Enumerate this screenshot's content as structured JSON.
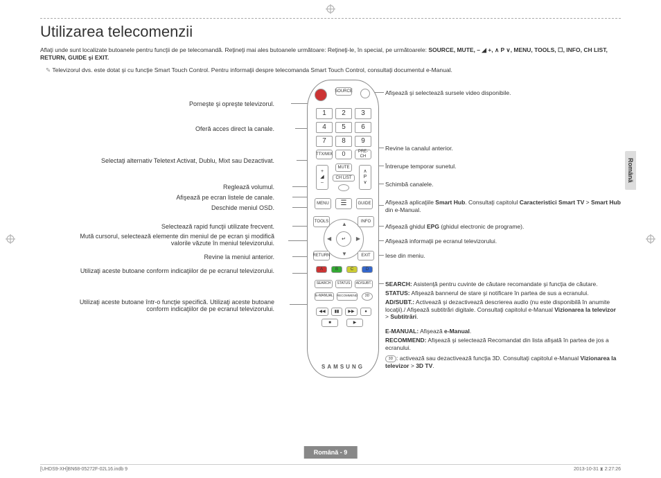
{
  "title": "Utilizarea telecomenzii",
  "intro": "Aflaţi unde sunt localizate butoanele pentru funcţii de pe telecomandă. Reţineţi mai ales butoanele următoare: Reţineţi-le, în special, pe următoarele: ",
  "introKeys": "SOURCE, MUTE, – ◢ +, ∧ P ∨, MENU, TOOLS, ☐, INFO, CH LIST, RETURN, GUIDE şi EXIT.",
  "note": "Televizorul dvs. este dotat şi cu funcţie Smart Touch Control. Pentru informaţii despre telecomanda Smart Touch Control, consultaţi documentul e-Manual.",
  "left": {
    "power": "Porneşte şi opreşte televizorul.",
    "direct": "Oferă acces direct la canale.",
    "ttx": "Selectaţi alternativ Teletext Activat, Dublu, Mixt sau Dezactivat.",
    "vol": "Reglează volumul.",
    "chlist": "Afişează pe ecran listele de canale.",
    "menu": "Deschide meniul OSD.",
    "tools": "Selectează rapid funcţii utilizate frecvent.",
    "nav": "Mută cursorul, selectează elemente din meniul de pe ecran şi modifică valorile văzute în meniul televizorului.",
    "return": "Revine la meniul anterior.",
    "colors": "Utilizaţi aceste butoane conform indicaţiilor de pe ecranul televizorului.",
    "bottom": "Utilizaţi aceste butoane într-o funcţie specifică. Utilizaţi aceste butoane conform indicaţiilor de pe ecranul televizorului."
  },
  "right": {
    "source": "Afişează şi selectează sursele video disponibile.",
    "prech": "Revine la canalul anterior.",
    "mute": "Întrerupe temporar sunetul.",
    "ch": "Schimbă canalele.",
    "smarthub": "Afişează aplicaţiile ",
    "smarthub_b1": "Smart Hub",
    "smarthub2": ". Consultaţi capitolul ",
    "smarthub_b2": "Caracteristici Smart TV",
    "smarthub3": " > ",
    "smarthub_b3": "Smart Hub",
    "smarthub4": " din e-Manual.",
    "guide": "Afişează ghidul ",
    "guide_b": "EPG",
    "guide2": " (ghidul electronic de programe).",
    "info": "Afişează informaţii pe ecranul televizorului.",
    "exit": "Iese din meniu.",
    "search_l": "SEARCH:",
    "search": " Asistenţă pentru cuvinte de căutare recomandate şi funcţia de căutare.",
    "status_l": "STATUS:",
    "status": " Afişează bannerul de stare şi notificare în partea de sus a ecranului.",
    "adsubt_l": "AD/SUBT.:",
    "adsubt": " Activează şi dezactivează descrierea audio (nu este disponibilă în anumite locaţii)./ Afişează subtitrări digitale. Consultaţi capitolul e-Manual ",
    "adsubt_b1": "Vizionarea la televizor",
    "adsubt2": " > ",
    "adsubt_b2": "Subtitrări",
    "adsubt3": ".",
    "eman_l": "E-MANUAL:",
    "eman": " Afişează ",
    "eman_b": "e-Manual",
    "eman2": ".",
    "rec_l": "RECOMMEND:",
    "rec": " Afişează şi selectează Recomandat din lista afişată în partea de jos a ecranului.",
    "d3": ": activează sau dezactivează funcţia 3D. Consultaţi capitolul e-Manual ",
    "d3_b1": "Vizionarea la televizor",
    "d32": " > ",
    "d3_b2": "3D TV",
    "d33": "."
  },
  "remote": {
    "source": "SOURCE",
    "ttx": "TTX/MIX",
    "prech": "PRE-CH",
    "mute": "MUTE",
    "chlist": "CH LIST",
    "menu": "MENU",
    "smarthub": "☰",
    "guide": "GUIDE",
    "tools": "TOOLS",
    "info": "INFO",
    "return": "RETURN",
    "exit": "EXIT",
    "search": "SEARCH",
    "status": "STATUS",
    "adsubt": "AD/SUBT.",
    "emanual": "E-MANUAL",
    "recommend": "RECOMMEND",
    "center": "↵",
    "brand": "SAMSUNG",
    "p": "P",
    "volicon": "◢",
    "k3d": "3D"
  },
  "tab": "Română",
  "pagenum": "Română - 9",
  "footer_l": "[UHDS9-XH]BN68-05272F-02L16.indb   9",
  "footer_r": "2013-10-31   ⧗ 2:27:26"
}
